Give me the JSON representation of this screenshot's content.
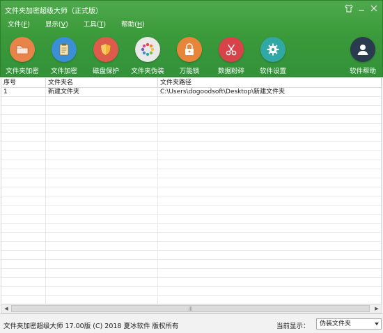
{
  "window": {
    "title": "文件夹加密超级大师（正式版）"
  },
  "menu": [
    {
      "label": "文件(",
      "key": "F",
      "tail": ")"
    },
    {
      "label": "显示(",
      "key": "V",
      "tail": ")"
    },
    {
      "label": "工具(",
      "key": "T",
      "tail": ")"
    },
    {
      "label": "帮助(",
      "key": "H",
      "tail": ")"
    }
  ],
  "toolbar": [
    {
      "label": "文件夹加密",
      "icon": "folder-icon",
      "color": "#e8834a"
    },
    {
      "label": "文件加密",
      "icon": "clipboard-icon",
      "color": "#3b8fd6"
    },
    {
      "label": "磁盘保护",
      "icon": "shield-icon",
      "color": "#de5a4c"
    },
    {
      "label": "文件夹伪装",
      "icon": "colorwheel-icon",
      "color": "#e9e9e9"
    },
    {
      "label": "万能锁",
      "icon": "lock-icon",
      "color": "#e7863a"
    },
    {
      "label": "数据粉碎",
      "icon": "scissors-icon",
      "color": "#d8434a"
    },
    {
      "label": "软件设置",
      "icon": "gear-icon",
      "color": "#2fa8a6"
    },
    {
      "label": "软件帮助",
      "icon": "user-icon",
      "color": "#2a3a4f"
    }
  ],
  "table": {
    "columns": [
      "序号",
      "文件夹名",
      "文件夹路径"
    ],
    "rows": [
      [
        "1",
        "新建文件夹",
        "C:\\Users\\dogoodsoft\\Desktop\\新建文件夹"
      ]
    ]
  },
  "scrollbar": {
    "grip": "|||"
  },
  "status": {
    "text": "文件夹加密超级大师 17.00版 (C) 2018  夏冰软件 版权所有",
    "current_label": "当前显示：",
    "current_value": "伪装文件夹"
  }
}
